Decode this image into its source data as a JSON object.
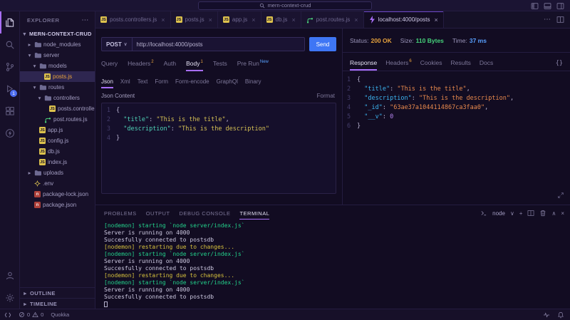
{
  "colors": {
    "accent": "#a86ef7",
    "send_button": "#3e76f5",
    "status_value": "#e5a13d",
    "size_value": "#46d37b",
    "time_value": "#58a0ff",
    "selected_file": "#e8a23d",
    "js_icon": "#ddc24d",
    "sup_badge": "#e8a23d",
    "new_badge": "#58a0ff",
    "term_green": "#23d18b",
    "term_yellow": "#d7c23d",
    "term_plain": "#ccc8e0",
    "req_key": "#4fd3b8",
    "req_str": "#d5c054",
    "res_key": "#3cb4f0",
    "res_str": "#e8894d",
    "res_num": "#b585f0"
  },
  "icons": {
    "more-actions": "⋯",
    "close": "×",
    "chevron-down": "∨",
    "chevron-up": "∧",
    "chevron-expanded": "▾",
    "chevron-collapsed": "▸",
    "plus": "+",
    "braces": "{}"
  },
  "titlebar": {
    "search_value": "mern-context-crud"
  },
  "activity_bar": {
    "items": [
      {
        "name": "explorer",
        "active": true
      },
      {
        "name": "search"
      },
      {
        "name": "source-control"
      },
      {
        "name": "debug",
        "badge": "1"
      },
      {
        "name": "extensions"
      },
      {
        "name": "thunder-client"
      }
    ],
    "bottom_items": [
      {
        "name": "account"
      },
      {
        "name": "settings"
      }
    ]
  },
  "sidebar": {
    "header": "EXPLORER",
    "root_label": "MERN-CONTEXT-CRUD",
    "tree": [
      {
        "label": "node_modules",
        "kind": "folder",
        "indent": 1
      },
      {
        "label": "server",
        "kind": "folder",
        "indent": 1,
        "expanded": true
      },
      {
        "label": "models",
        "kind": "folder",
        "indent": 2,
        "expanded": true
      },
      {
        "label": "posts.js",
        "kind": "js",
        "indent": 3,
        "selected": true
      },
      {
        "label": "routes",
        "kind": "folder",
        "indent": 2,
        "expanded": true
      },
      {
        "label": "controllers",
        "kind": "folder",
        "indent": 3,
        "expanded": true
      },
      {
        "label": "posts.controllers.js",
        "kind": "js",
        "indent": 4
      },
      {
        "label": "post.routes.js",
        "kind": "route",
        "indent": 3
      },
      {
        "label": "app.js",
        "kind": "js",
        "indent": 2
      },
      {
        "label": "config.js",
        "kind": "js",
        "indent": 2
      },
      {
        "label": "db.js",
        "kind": "js",
        "indent": 2
      },
      {
        "label": "index.js",
        "kind": "js",
        "indent": 2
      },
      {
        "label": "uploads",
        "kind": "folder",
        "indent": 1
      },
      {
        "label": ".env",
        "kind": "env",
        "indent": 1
      },
      {
        "label": "package-lock.json",
        "kind": "npm",
        "indent": 1
      },
      {
        "label": "package.json",
        "kind": "npm",
        "indent": 1
      }
    ],
    "bottom_sections": [
      {
        "label": "OUTLINE"
      },
      {
        "label": "TIMELINE"
      }
    ]
  },
  "editor_tabs": [
    {
      "label": "posts.controllers.js",
      "icon": "js"
    },
    {
      "label": "posts.js",
      "icon": "js"
    },
    {
      "label": "app.js",
      "icon": "js"
    },
    {
      "label": "db.js",
      "icon": "js"
    },
    {
      "label": "post.routes.js",
      "icon": "route"
    },
    {
      "label": "localhost:4000/posts",
      "icon": "tc",
      "active": true
    }
  ],
  "request": {
    "method": "POST",
    "url": "http://localhost:4000/posts",
    "send_label": "Send",
    "tabs": [
      {
        "label": "Query"
      },
      {
        "label": "Headers",
        "sup": "2"
      },
      {
        "label": "Auth"
      },
      {
        "label": "Body",
        "sup": "1",
        "active": true
      },
      {
        "label": "Tests"
      },
      {
        "label": "Pre Run",
        "sup": "New"
      }
    ],
    "body_tabs": [
      {
        "label": "Json",
        "active": true
      },
      {
        "label": "Xml"
      },
      {
        "label": "Text"
      },
      {
        "label": "Form"
      },
      {
        "label": "Form-encode"
      },
      {
        "label": "GraphQl"
      },
      {
        "label": "Binary"
      }
    ],
    "content_label": "Json Content",
    "format_label": "Format",
    "code_lines": [
      [
        {
          "t": "{",
          "c": "p"
        }
      ],
      [
        {
          "t": "  ",
          "c": "p"
        },
        {
          "t": "\"title\"",
          "c": "k"
        },
        {
          "t": ": ",
          "c": "p"
        },
        {
          "t": "\"This is the title\"",
          "c": "s"
        },
        {
          "t": ",",
          "c": "p"
        }
      ],
      [
        {
          "t": "  ",
          "c": "p"
        },
        {
          "t": "\"description\"",
          "c": "k"
        },
        {
          "t": ": ",
          "c": "p"
        },
        {
          "t": "\"This is the description\"",
          "c": "s"
        }
      ],
      [
        {
          "t": "}",
          "c": "p"
        }
      ]
    ]
  },
  "response": {
    "status": {
      "label": "Status:",
      "value": "200 OK"
    },
    "size": {
      "label": "Size:",
      "value": "110 Bytes"
    },
    "time": {
      "label": "Time:",
      "value": "37 ms"
    },
    "tabs": [
      {
        "label": "Response",
        "active": true
      },
      {
        "label": "Headers",
        "sup": "6"
      },
      {
        "label": "Cookies"
      },
      {
        "label": "Results"
      },
      {
        "label": "Docs"
      }
    ],
    "code_lines": [
      [
        {
          "t": "{",
          "c": "p"
        }
      ],
      [
        {
          "t": "  ",
          "c": "p"
        },
        {
          "t": "\"title\"",
          "c": "k"
        },
        {
          "t": ": ",
          "c": "p"
        },
        {
          "t": "\"This is the title\"",
          "c": "s"
        },
        {
          "t": ",",
          "c": "p"
        }
      ],
      [
        {
          "t": "  ",
          "c": "p"
        },
        {
          "t": "\"description\"",
          "c": "k"
        },
        {
          "t": ": ",
          "c": "p"
        },
        {
          "t": "\"This is the description\"",
          "c": "s"
        },
        {
          "t": ",",
          "c": "p"
        }
      ],
      [
        {
          "t": "  ",
          "c": "p"
        },
        {
          "t": "\"_id\"",
          "c": "k"
        },
        {
          "t": ": ",
          "c": "p"
        },
        {
          "t": "\"63ae37a1044114867ca3faa0\"",
          "c": "s"
        },
        {
          "t": ",",
          "c": "p"
        }
      ],
      [
        {
          "t": "  ",
          "c": "p"
        },
        {
          "t": "\"__v\"",
          "c": "k"
        },
        {
          "t": ": ",
          "c": "p"
        },
        {
          "t": "0",
          "c": "n"
        }
      ],
      [
        {
          "t": "}",
          "c": "p"
        }
      ]
    ]
  },
  "panel": {
    "tabs": [
      {
        "label": "PROBLEMS"
      },
      {
        "label": "OUTPUT"
      },
      {
        "label": "DEBUG CONSOLE"
      },
      {
        "label": "TERMINAL",
        "active": true
      }
    ],
    "shell_label": "node",
    "terminal_lines": [
      {
        "text": "[nodemon] starting `node server/index.js`",
        "color": "green"
      },
      {
        "text": "Server is running on 4000",
        "color": "plain"
      },
      {
        "text": "Succesfully connected to postsdb",
        "color": "plain"
      },
      {
        "text": "[nodemon] restarting due to changes...",
        "color": "yellow"
      },
      {
        "text": "[nodemon] starting `node server/index.js`",
        "color": "green"
      },
      {
        "text": "Server is running on 4000",
        "color": "plain"
      },
      {
        "text": "Succesfully connected to postsdb",
        "color": "plain"
      },
      {
        "text": "[nodemon] restarting due to changes...",
        "color": "yellow"
      },
      {
        "text": "[nodemon] starting `node server/index.js`",
        "color": "green"
      },
      {
        "text": "Server is running on 4000",
        "color": "plain"
      },
      {
        "text": "Succesfully connected to postsdb",
        "color": "plain"
      }
    ]
  },
  "statusbar": {
    "errors": "0",
    "warnings": "0",
    "quokka_label": "Quokka"
  }
}
